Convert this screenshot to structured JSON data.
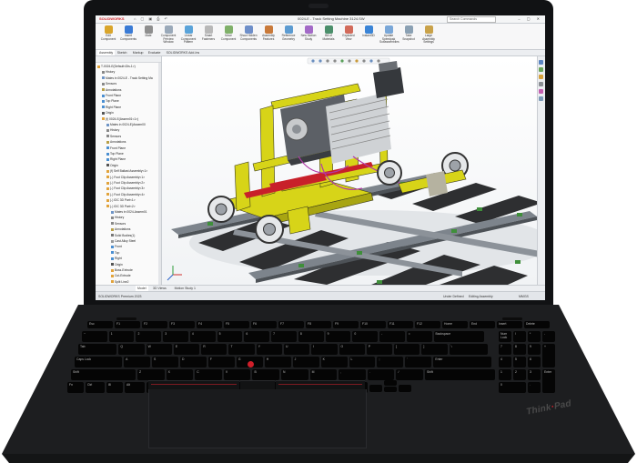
{
  "window": {
    "app_logo": "SOLIDWORKS",
    "quick_access": "⌂ ▢ ▣ ⎙ ↶",
    "document_title": "0024-E - Track Setting Machine 3124.SW",
    "search_placeholder": "Search Commands",
    "window_controls": "– ▢ ✕"
  },
  "ribbon": {
    "buttons": [
      {
        "label": "Edit Component",
        "color": "#d9a52b"
      },
      {
        "label": "Insert Components",
        "color": "#3a7bd5"
      },
      {
        "label": "Mate",
        "color": "#8e8e8e"
      },
      {
        "label": "Component Preview Window",
        "color": "#9aa9b9"
      },
      {
        "label": "Linear Component Pattern",
        "color": "#5aa3d9"
      },
      {
        "label": "Smart Fasteners",
        "color": "#b8b8b8"
      },
      {
        "label": "Move Component",
        "color": "#7fb069"
      },
      {
        "label": "Show Hidden Components",
        "color": "#6e8fc9"
      },
      {
        "label": "Assembly Features",
        "color": "#c97a3a"
      },
      {
        "label": "Reference Geometry",
        "color": "#5c9bd1"
      },
      {
        "label": "New Motion Study",
        "color": "#a36ac7"
      },
      {
        "label": "Bill of Materials",
        "color": "#4b8f6b"
      },
      {
        "label": "Exploded View",
        "color": "#d26b5b"
      },
      {
        "label": "Instant3D",
        "color": "#3a84d6"
      },
      {
        "label": "Update Speedpak Subassemblies",
        "color": "#79a7d8"
      },
      {
        "label": "Take Snapshot",
        "color": "#8aa0b3"
      },
      {
        "label": "Large Assembly Settings",
        "color": "#c9a24a"
      }
    ]
  },
  "command_tabs": [
    "Assembly",
    "Sketch",
    "Markup",
    "Evaluate",
    "SOLIDWORKS Add-Ins"
  ],
  "tree": {
    "items": [
      {
        "label": "T-0024-E(Default<Dis-1>)",
        "indent": 0,
        "color": "#e1a33c"
      },
      {
        "label": "History",
        "indent": 1,
        "color": "#888888"
      },
      {
        "label": "Mates in 0024-E - Track Setting Ma",
        "indent": 1,
        "color": "#6f95c6"
      },
      {
        "label": "Sensors",
        "indent": 1,
        "color": "#888888"
      },
      {
        "label": "Annotations",
        "indent": 1,
        "color": "#b8a049"
      },
      {
        "label": "Front Plane",
        "indent": 1,
        "color": "#4b8fd1"
      },
      {
        "label": "Top Plane",
        "indent": 1,
        "color": "#4b8fd1"
      },
      {
        "label": "Right Plane",
        "indent": 1,
        "color": "#4b8fd1"
      },
      {
        "label": "Origin",
        "indent": 1,
        "color": "#555555"
      },
      {
        "label": "(f) 0024-E(Assem01<1>)",
        "indent": 1,
        "color": "#e1a33c"
      },
      {
        "label": "Mates in 0024-E(Assem00",
        "indent": 2,
        "color": "#6f95c6"
      },
      {
        "label": "History",
        "indent": 2,
        "color": "#888888"
      },
      {
        "label": "Sensors",
        "indent": 2,
        "color": "#888888"
      },
      {
        "label": "Annotations",
        "indent": 2,
        "color": "#b8a049"
      },
      {
        "label": "Front Plane",
        "indent": 2,
        "color": "#4b8fd1"
      },
      {
        "label": "Top Plane",
        "indent": 2,
        "color": "#4b8fd1"
      },
      {
        "label": "Right Plane",
        "indent": 2,
        "color": "#4b8fd1"
      },
      {
        "label": "Origin",
        "indent": 2,
        "color": "#555555"
      },
      {
        "label": "(f) Self Ballast Assembly<1>",
        "indent": 2,
        "color": "#e1a33c"
      },
      {
        "label": "(-) Foot Clip Assembly<1>",
        "indent": 2,
        "color": "#e1a33c"
      },
      {
        "label": "(-) Foot Clip Assembly<2>",
        "indent": 2,
        "color": "#e1a33c"
      },
      {
        "label": "(-) Foot Clip Assembly<3>",
        "indent": 2,
        "color": "#e1a33c"
      },
      {
        "label": "(-) Foot Clip Assembly<4>",
        "indent": 2,
        "color": "#e1a33c"
      },
      {
        "label": "(-) IDC 3D Part<1>",
        "indent": 2,
        "color": "#e1a33c"
      },
      {
        "label": "(-) IDC 3D Part<2>",
        "indent": 2,
        "color": "#e1a33c"
      },
      {
        "label": "Mates in 0024-Assem01",
        "indent": 3,
        "color": "#6f95c6"
      },
      {
        "label": "History",
        "indent": 3,
        "color": "#888888"
      },
      {
        "label": "Sensors",
        "indent": 3,
        "color": "#888888"
      },
      {
        "label": "Annotations",
        "indent": 3,
        "color": "#b8a049"
      },
      {
        "label": "Solid Bodies(1)",
        "indent": 3,
        "color": "#777777"
      },
      {
        "label": "Cast Alloy Steel",
        "indent": 3,
        "color": "#999999"
      },
      {
        "label": "Front",
        "indent": 3,
        "color": "#4b8fd1"
      },
      {
        "label": "Top",
        "indent": 3,
        "color": "#4b8fd1"
      },
      {
        "label": "Right",
        "indent": 3,
        "color": "#4b8fd1"
      },
      {
        "label": "Origin",
        "indent": 3,
        "color": "#555555"
      },
      {
        "label": "Boss-Extrude",
        "indent": 3,
        "color": "#e1a33c"
      },
      {
        "label": "Cut-Extrude",
        "indent": 3,
        "color": "#e1a33c"
      },
      {
        "label": "Split Line2",
        "indent": 3,
        "color": "#e1a33c"
      }
    ]
  },
  "view_tabs": [
    "Model",
    "3D Views",
    "Motion Study 1"
  ],
  "status": {
    "left": "SOLIDWORKS Premium 2023",
    "mode": "Under Defined",
    "editing": "Editing Assembly",
    "units": "MMGS"
  },
  "keyboard": {
    "fn_row": [
      "Esc",
      "F1",
      "F2",
      "F3",
      "F4",
      "F5",
      "F6",
      "F7",
      "F8",
      "F9",
      "F10",
      "F11",
      "F12",
      "Home",
      "End",
      "Insert",
      "Delete"
    ],
    "number_row": [
      "~",
      "1",
      "2",
      "3",
      "4",
      "5",
      "6",
      "7",
      "8",
      "9",
      "0",
      "-",
      "=",
      "Backspace"
    ],
    "top_row": [
      "Tab",
      "Q",
      "W",
      "E",
      "R",
      "T",
      "Y",
      "U",
      "I",
      "O",
      "P",
      "[",
      "]",
      "\\"
    ],
    "home_row": [
      "Caps Lock",
      "A",
      "S",
      "D",
      "F",
      "G",
      "H",
      "J",
      "K",
      "L",
      ";",
      "'",
      "Enter"
    ],
    "bottom_row": [
      "Shift",
      "Z",
      "X",
      "C",
      "V",
      "B",
      "N",
      "M",
      ",",
      ".",
      "/",
      "Shift"
    ],
    "space_row": [
      "Fn",
      "Ctrl",
      "⊞",
      "Alt",
      "Alt",
      "PrtSc",
      "Ctrl"
    ],
    "numpad": [
      "Num Lock",
      "/",
      "*",
      "-",
      "7",
      "8",
      "9",
      "+",
      "4",
      "5",
      "6",
      "1",
      "2",
      "3",
      "Enter",
      "0",
      "."
    ]
  },
  "brand": {
    "text_a": "Think",
    "text_b": "Pad"
  },
  "colors": {
    "machine_yellow": "#d7d418",
    "rail_gray": "#7d848c",
    "trackpoint_red": "#d01f2a",
    "clip_green": "#3f8f3a"
  }
}
